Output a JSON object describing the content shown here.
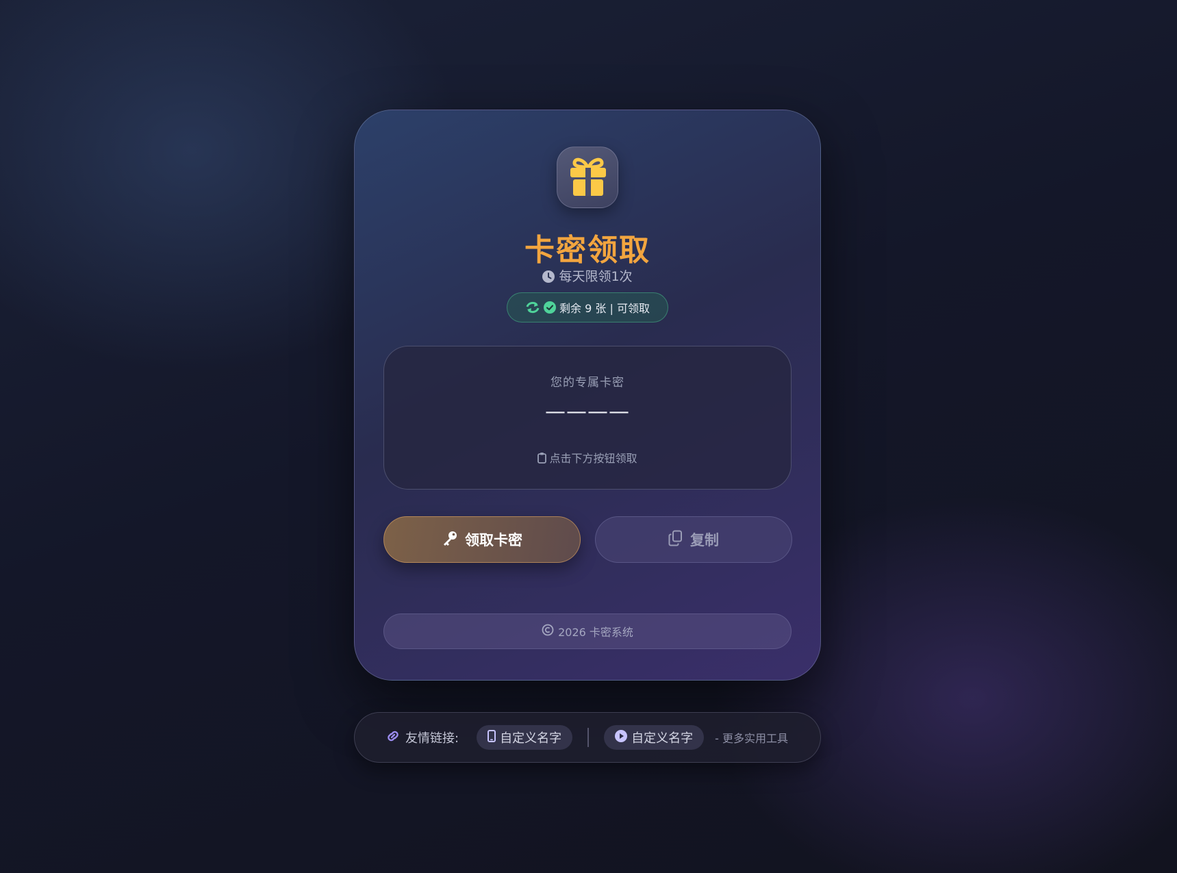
{
  "app": {
    "title": "卡密领取",
    "subtitle": "每天限领1次"
  },
  "status": {
    "text": "剩余 9 张 | 可领取",
    "color": "#4fd39a"
  },
  "key_card": {
    "label": "您的专属卡密",
    "value": "————",
    "hint": "点击下方按钮领取"
  },
  "buttons": {
    "claim_label": "领取卡密",
    "copy_label": "复制"
  },
  "footer": {
    "copyright": "2026 卡密系统"
  },
  "links": {
    "label": "友情链接:",
    "items": [
      {
        "label": "自定义名字",
        "icon": "phone-icon"
      },
      {
        "label": "自定义名字",
        "icon": "play-circle-icon"
      }
    ],
    "more": "- 更多实用工具"
  },
  "colors": {
    "accent": "#f2a53f",
    "gift": "#fcc947",
    "link_icon": "#9b8cf0"
  }
}
